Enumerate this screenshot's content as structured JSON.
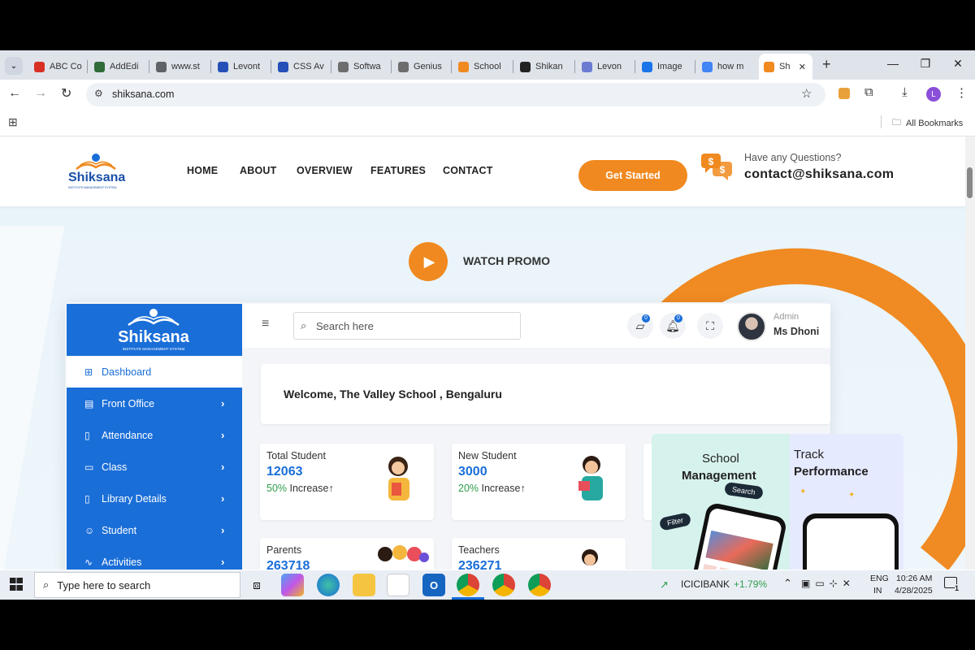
{
  "browser": {
    "tabs": [
      {
        "label": "ABC Co",
        "icon": "gmail-icon",
        "color": "#d93025"
      },
      {
        "label": "AddEdi",
        "icon": "star-app-icon",
        "color": "#2f6b3b"
      },
      {
        "label": "www.st",
        "icon": "globe-icon",
        "color": "#5f6368"
      },
      {
        "label": "Levont",
        "icon": "di-icon",
        "color": "#2450b8"
      },
      {
        "label": "CSS Av",
        "icon": "di-icon",
        "color": "#2450b8"
      },
      {
        "label": "Softwa",
        "icon": "doc-icon",
        "color": "#6d6d6d"
      },
      {
        "label": "Genius",
        "icon": "doc-icon",
        "color": "#6d6d6d"
      },
      {
        "label": "School",
        "icon": "school-icon",
        "color": "#f0891f"
      },
      {
        "label": "Shikan",
        "icon": "circle-dark-icon",
        "color": "#222222"
      },
      {
        "label": "Levon",
        "icon": "pen-icon",
        "color": "#6c7bd1"
      },
      {
        "label": "Image",
        "icon": "image-icon",
        "color": "#1a73e8"
      },
      {
        "label": "how m",
        "icon": "google-icon",
        "color": "#4285f4"
      },
      {
        "label": "Sh",
        "icon": "school-icon",
        "color": "#f0891f",
        "active": true
      }
    ],
    "new_tab": "+",
    "url": "shiksana.com",
    "profile_initial": "L",
    "all_bookmarks": "All Bookmarks"
  },
  "site": {
    "logo_text": "Shiksana",
    "logo_tagline": "INSTITUTE MANAGEMENT SYSTEM",
    "nav": [
      "HOME",
      "ABOUT",
      "OVERVIEW",
      "FEATURES",
      "CONTACT"
    ],
    "cta": "Get Started",
    "question": "Have any Questions?",
    "email": "contact@shiksana.com",
    "watch_promo": "WATCH PROMO",
    "accent": "#f0891f",
    "primary": "#1a6ed8"
  },
  "dashboard": {
    "search_placeholder": "Search here",
    "admin_role": "Admin",
    "admin_name": "Ms Dhoni",
    "notif_count_1": "0",
    "notif_count_2": "0",
    "welcome": "Welcome, The Valley School , Bengaluru",
    "sidebar": [
      {
        "label": "Dashboard",
        "active": true
      },
      {
        "label": "Front Office"
      },
      {
        "label": "Attendance"
      },
      {
        "label": "Class"
      },
      {
        "label": "Library Details"
      },
      {
        "label": "Student"
      },
      {
        "label": "Activities"
      }
    ],
    "cards": [
      {
        "title": "Total Student",
        "value": "12063",
        "note_pct": "50%",
        "note_text": " Increase↑"
      },
      {
        "title": "New Student",
        "value": "3000",
        "note_pct": "20%",
        "note_text": " Increase↑"
      },
      {
        "title": "Parents",
        "value": "263718"
      },
      {
        "title": "Teachers",
        "value": "236271"
      }
    ],
    "promo_left_title_1": "School",
    "promo_left_title_2": "Management",
    "promo_right_title_1": "Track",
    "promo_right_title_2": "Performance",
    "promo_search": "Search",
    "promo_filter": "Filter"
  },
  "taskbar": {
    "search_placeholder": "Type here to search",
    "stock_name": "ICICIBANK",
    "stock_change": "+1.79%",
    "lang_1": "ENG",
    "lang_2": "IN",
    "time": "10:26 AM",
    "date": "4/28/2025",
    "notif_count": "1"
  }
}
